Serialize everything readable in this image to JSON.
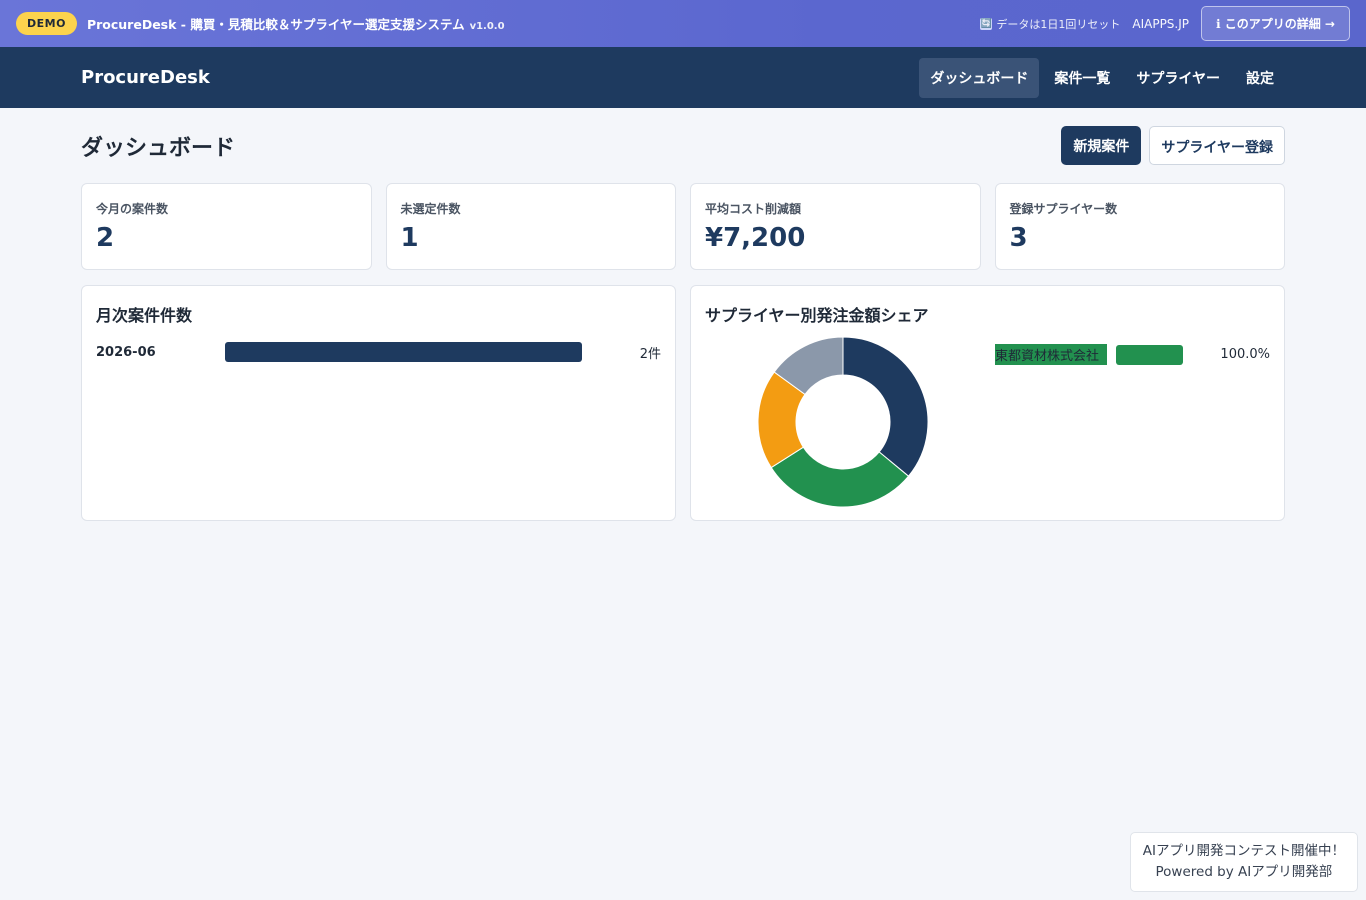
{
  "demo_bar": {
    "badge": "DEMO",
    "title": "ProcureDesk - 購買・見積比較＆サプライヤー選定支援システム",
    "version": "v1.0.0",
    "reset_icon": "🔄",
    "reset_note": "データは1日1回リセット",
    "site": "AIAPPS.JP",
    "detail_button": "ℹ このアプリの詳細 →"
  },
  "navbar": {
    "brand": "ProcureDesk",
    "links": [
      {
        "label": "ダッシュボード",
        "active": true
      },
      {
        "label": "案件一覧",
        "active": false
      },
      {
        "label": "サプライヤー",
        "active": false
      },
      {
        "label": "設定",
        "active": false
      }
    ]
  },
  "page": {
    "title": "ダッシュボード",
    "new_case_button": "新規案件",
    "register_supplier_button": "サプライヤー登録"
  },
  "stats": [
    {
      "label": "今月の案件数",
      "value": "2"
    },
    {
      "label": "未選定件数",
      "value": "1"
    },
    {
      "label": "平均コスト削減額",
      "value": "¥7,200"
    },
    {
      "label": "登録サプライヤー数",
      "value": "3"
    }
  ],
  "monthly_panel": {
    "title": "月次案件件数",
    "rows": [
      {
        "month": "2026-06",
        "count_label": "2件",
        "fraction": 1.0
      }
    ]
  },
  "share_panel": {
    "title": "サプライヤー別発注金額シェア",
    "legend": [
      {
        "name": "東都資材株式会社",
        "percent_label": "100.0%",
        "fraction": 1.0
      }
    ]
  },
  "chart_data": {
    "type": "pie",
    "values": [
      36,
      30,
      19,
      15
    ],
    "colors": [
      "#1e3a5f",
      "#22914f",
      "#f39c12",
      "#8b98aa"
    ]
  },
  "footer": {
    "line1": "AIアプリ開発コンテスト開催中！",
    "line2": "Powered by AIアプリ開発部"
  }
}
